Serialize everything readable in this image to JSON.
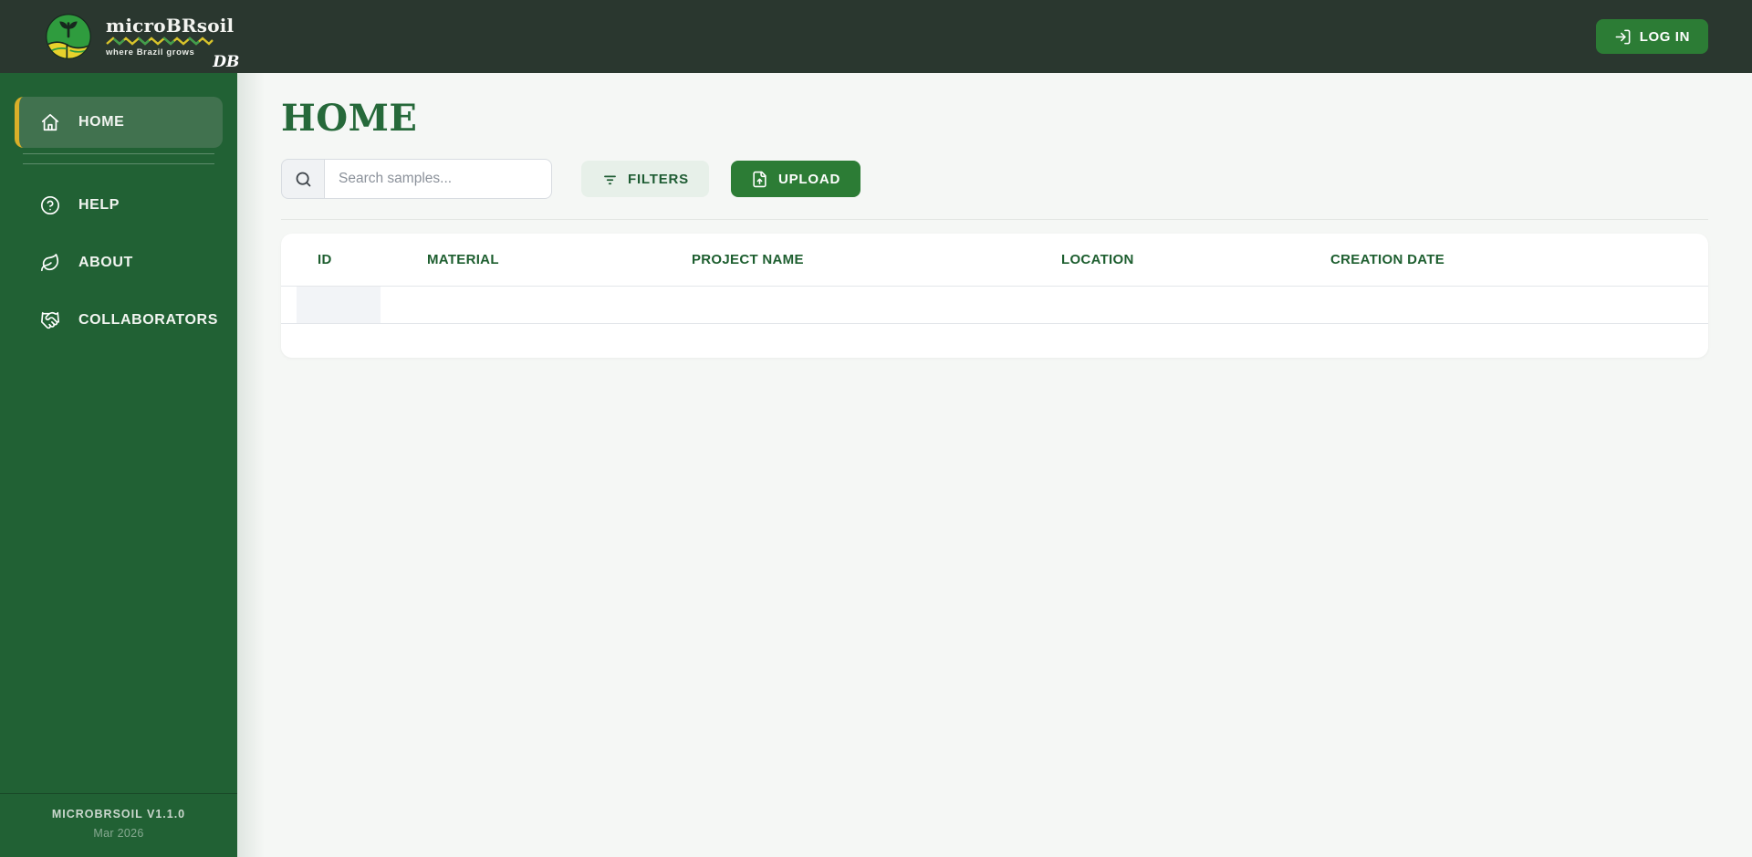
{
  "theme": {
    "header_bg": "#2a372f",
    "sidebar_bg": "#216134",
    "sidebar_active_bg": "#41724f",
    "accent_yellow": "#d9af29",
    "brand_green": "#2c7c35",
    "light_button_bg": "#e7f0e9",
    "title_green": "#26693a",
    "table_header_green": "#1d5e2f",
    "main_bg": "#f5f7f5"
  },
  "header": {
    "logo": {
      "name": "microBRsoil",
      "tagline": "where Brazil grows",
      "suffix": "DB",
      "icon": "plant-field-logo-icon"
    },
    "login": {
      "label": "LOG IN",
      "icon": "log-in-icon"
    }
  },
  "sidebar": {
    "items": [
      {
        "label": "HOME",
        "icon": "home-icon",
        "active": true
      },
      {
        "label": "HELP",
        "icon": "help-circle-icon",
        "active": false
      },
      {
        "label": "ABOUT",
        "icon": "leaf-icon",
        "active": false
      },
      {
        "label": "COLLABORATORS",
        "icon": "handshake-icon",
        "active": false
      }
    ],
    "footer": {
      "version": "MICROBRSOIL V1.1.0",
      "date": "Mar 2026"
    }
  },
  "main": {
    "title": "HOME",
    "search": {
      "placeholder": "Search samples...",
      "icon": "search-icon"
    },
    "buttons": {
      "filters": "FILTERS",
      "filters_icon": "filter-lines-icon",
      "upload": "UPLOAD",
      "upload_icon": "file-upload-icon"
    },
    "table": {
      "columns": [
        "ID",
        "MATERIAL",
        "PROJECT NAME",
        "LOCATION",
        "CREATION DATE"
      ],
      "rows": [],
      "loading_skeleton": true
    }
  }
}
